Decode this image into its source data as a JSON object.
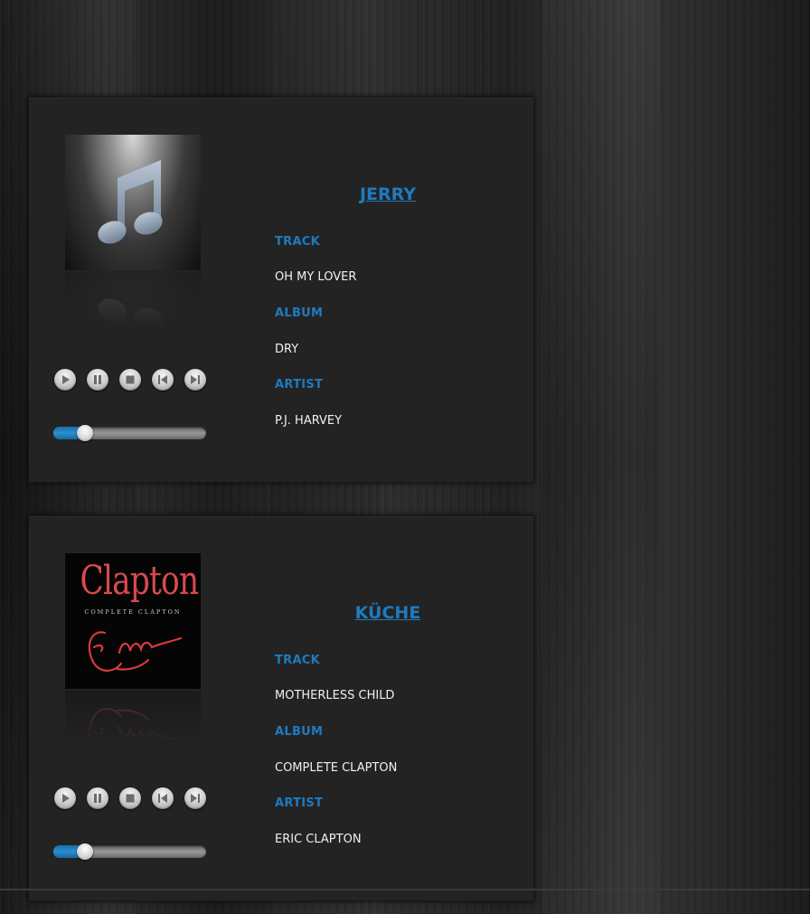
{
  "players": [
    {
      "room": "JERRY",
      "cover": "music-note-icon",
      "track_label": "TRACK",
      "track": "OH MY LOVER",
      "album_label": "ALBUM",
      "album": "DRY",
      "artist_label": "ARTIST",
      "artist": "P.J. HARVEY",
      "progress": 0.21
    },
    {
      "room": "KÜCHE",
      "cover": "clapton-album-art",
      "cover_title": "Clapton",
      "cover_subtitle": "COMPLETE CLAPTON",
      "track_label": "TRACK",
      "track": "MOTHERLESS CHILD",
      "album_label": "ALBUM",
      "album": "COMPLETE CLAPTON",
      "artist_label": "ARTIST",
      "artist": "ERIC CLAPTON",
      "progress": 0.21
    }
  ],
  "controls": [
    "play-icon",
    "pause-icon",
    "stop-icon",
    "previous-icon",
    "next-icon"
  ],
  "colors": {
    "accent": "#1e7bbf",
    "panel": "#232323",
    "text": "#f0f0f0"
  }
}
